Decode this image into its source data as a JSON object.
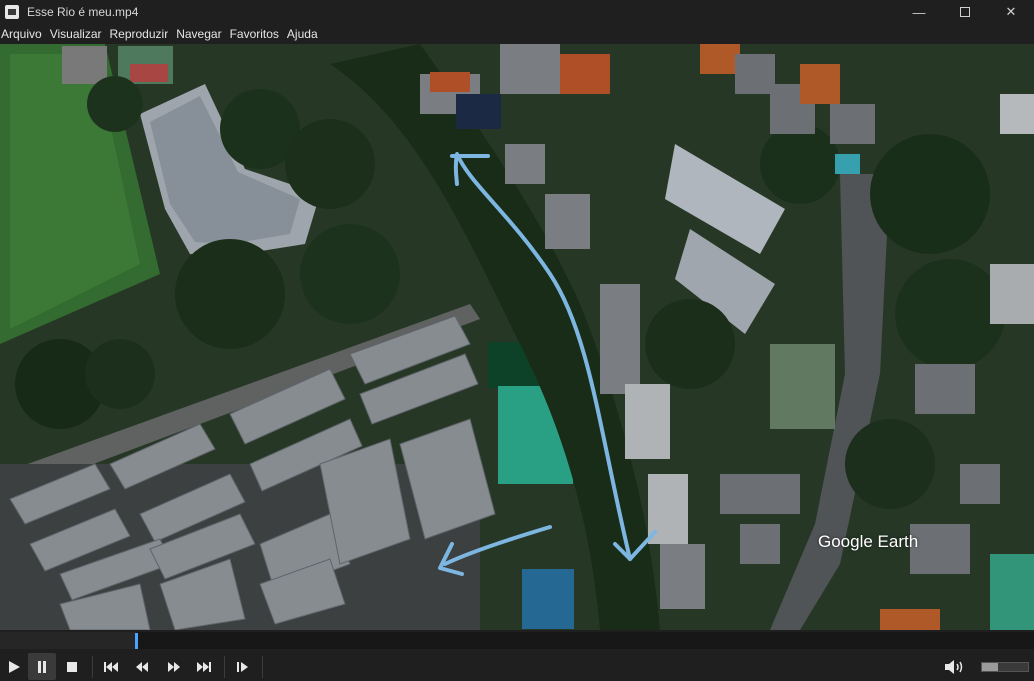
{
  "window": {
    "title": "Esse Rio é meu.mp4",
    "minimize_icon": "minimize-icon",
    "maximize_icon": "maximize-icon",
    "close_icon": "close-icon"
  },
  "menu": [
    "Arquivo",
    "Visualizar",
    "Reproduzir",
    "Navegar",
    "Favoritos",
    "Ajuda"
  ],
  "video": {
    "watermark": "Google Earth"
  },
  "player": {
    "progress": 0.132,
    "volume": 0.35,
    "buttons": [
      "play-icon",
      "pause-icon",
      "stop-icon",
      "skip-previous-icon",
      "rewind-icon",
      "fast-forward-icon",
      "skip-next-icon",
      "frame-step-icon",
      "volume-icon"
    ]
  },
  "colors": {
    "accent": "#4aa3ff",
    "chrome": "#1f1f1f",
    "route": "#8fd0ff"
  }
}
